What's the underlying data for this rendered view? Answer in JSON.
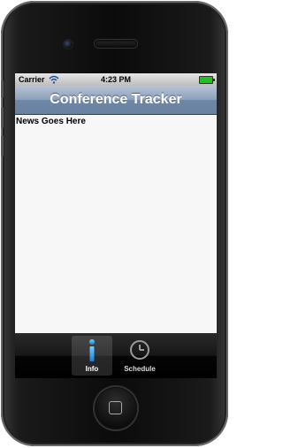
{
  "status_bar": {
    "carrier": "Carrier",
    "time": "4:23 PM",
    "wifi_icon": "wifi-icon",
    "battery_icon": "battery-icon",
    "battery_color": "#1fc21f"
  },
  "nav": {
    "title": "Conference Tracker"
  },
  "content": {
    "news": "News Goes Here"
  },
  "tabs": [
    {
      "label": "Info",
      "icon": "info-icon",
      "active": true,
      "color": "#2f9ff0"
    },
    {
      "label": "Schedule",
      "icon": "clock-icon",
      "active": false,
      "color": "#9a9a9a"
    }
  ]
}
